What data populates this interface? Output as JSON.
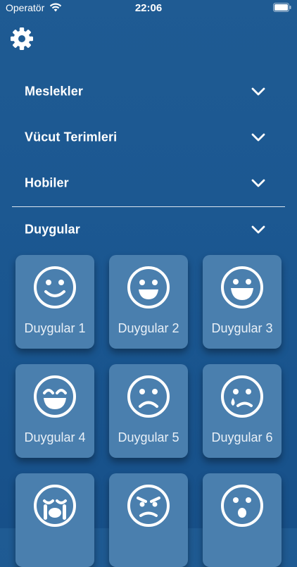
{
  "status_bar": {
    "carrier": "Operatör",
    "time": "22:06",
    "wifi_icon": "wifi-icon",
    "battery_icon": "battery-icon"
  },
  "toolbar": {
    "settings_icon": "gear-icon"
  },
  "sections": [
    {
      "label": "Meslekler",
      "icon": "chevron-down-icon"
    },
    {
      "label": "Vücut Terimleri",
      "icon": "chevron-down-icon"
    },
    {
      "label": "Hobiler",
      "icon": "chevron-down-icon"
    },
    {
      "label": "Duygular",
      "icon": "chevron-down-icon"
    }
  ],
  "emotions": [
    {
      "label": "Duygular 1",
      "icon": "smile-face-icon"
    },
    {
      "label": "Duygular 2",
      "icon": "happy-face-icon"
    },
    {
      "label": "Duygular 3",
      "icon": "grin-face-icon"
    },
    {
      "label": "Duygular 4",
      "icon": "laughing-face-icon"
    },
    {
      "label": "Duygular 5",
      "icon": "sad-face-icon"
    },
    {
      "label": "Duygular 6",
      "icon": "crying-face-icon"
    },
    {
      "label": "",
      "icon": "sobbing-face-icon"
    },
    {
      "label": "",
      "icon": "angry-face-icon"
    },
    {
      "label": "",
      "icon": "surprised-face-icon"
    }
  ],
  "colors": {
    "background": "#1c5891",
    "card": "#4a7fae",
    "text": "#ffffff"
  }
}
